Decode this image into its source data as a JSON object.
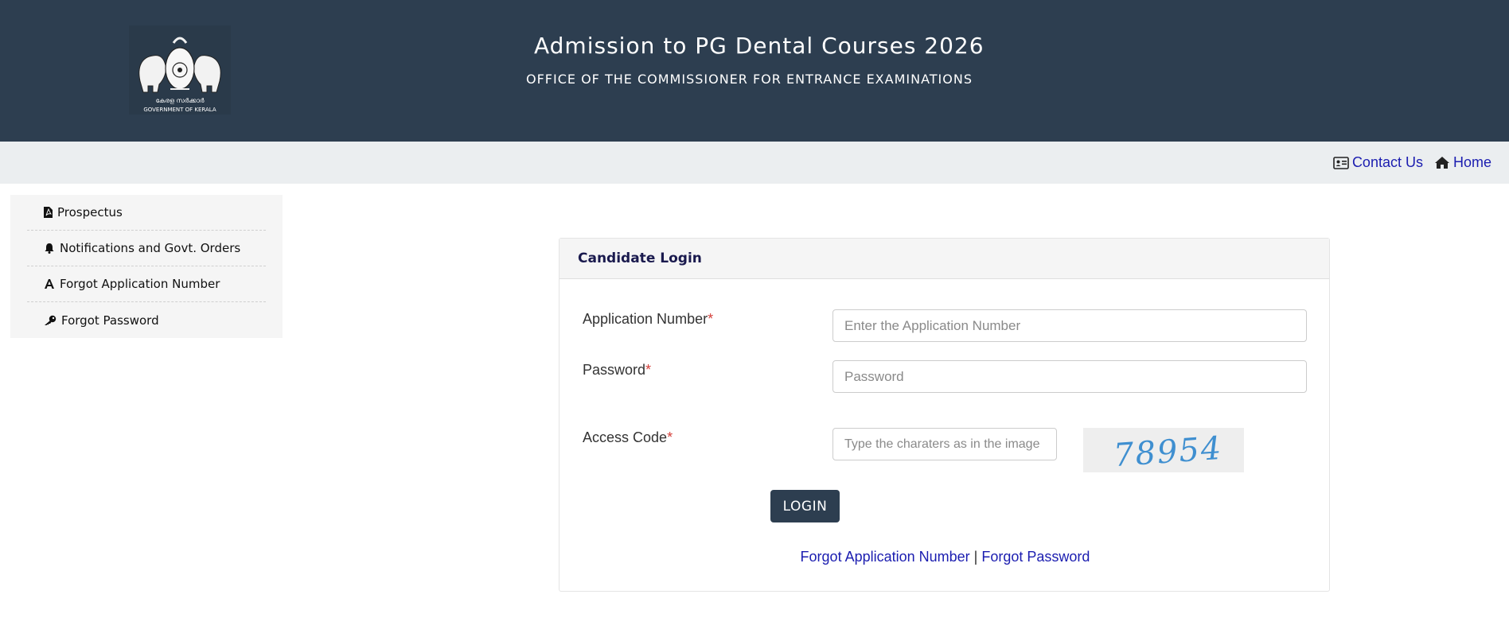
{
  "header": {
    "title": "Admission to PG Dental Courses 2026",
    "subtitle": "OFFICE OF THE COMMISSIONER FOR ENTRANCE EXAMINATIONS",
    "emblem_text_local": "കേരള സർക്കാർ",
    "emblem_text": "GOVERNMENT OF KERALA"
  },
  "topbar": {
    "contact_label": "Contact Us",
    "contact_icon": "contact-card-icon",
    "home_label": "Home",
    "home_icon": "home-icon"
  },
  "sidebar": {
    "items": [
      {
        "label": "Prospectus",
        "icon": "pdf-file-icon"
      },
      {
        "label": "Notifications and Govt. Orders",
        "icon": "bell-icon"
      },
      {
        "label": "Forgot Application Number",
        "icon": "font-a-icon"
      },
      {
        "label": "Forgot Password",
        "icon": "key-icon"
      }
    ]
  },
  "login": {
    "title": "Candidate Login",
    "application_number_label": "Application Number",
    "application_number_placeholder": "Enter the Application Number",
    "application_number_value": "",
    "password_label": "Password",
    "password_placeholder": "Password",
    "password_value": "",
    "access_code_label": "Access Code",
    "access_code_placeholder": "Type the charaters as in the image",
    "access_code_value": "",
    "captcha_text": "78954",
    "required_mark": "*",
    "login_button": "LOGIN",
    "forgot_app_link": "Forgot Application Number",
    "separator": "|",
    "forgot_password_link": "Forgot Password"
  },
  "colors": {
    "header_bg": "#2d3e50",
    "topbar_bg": "#ebeef0",
    "link": "#1b1db0",
    "required": "#d43f3a",
    "button_bg": "#2d3e50"
  }
}
